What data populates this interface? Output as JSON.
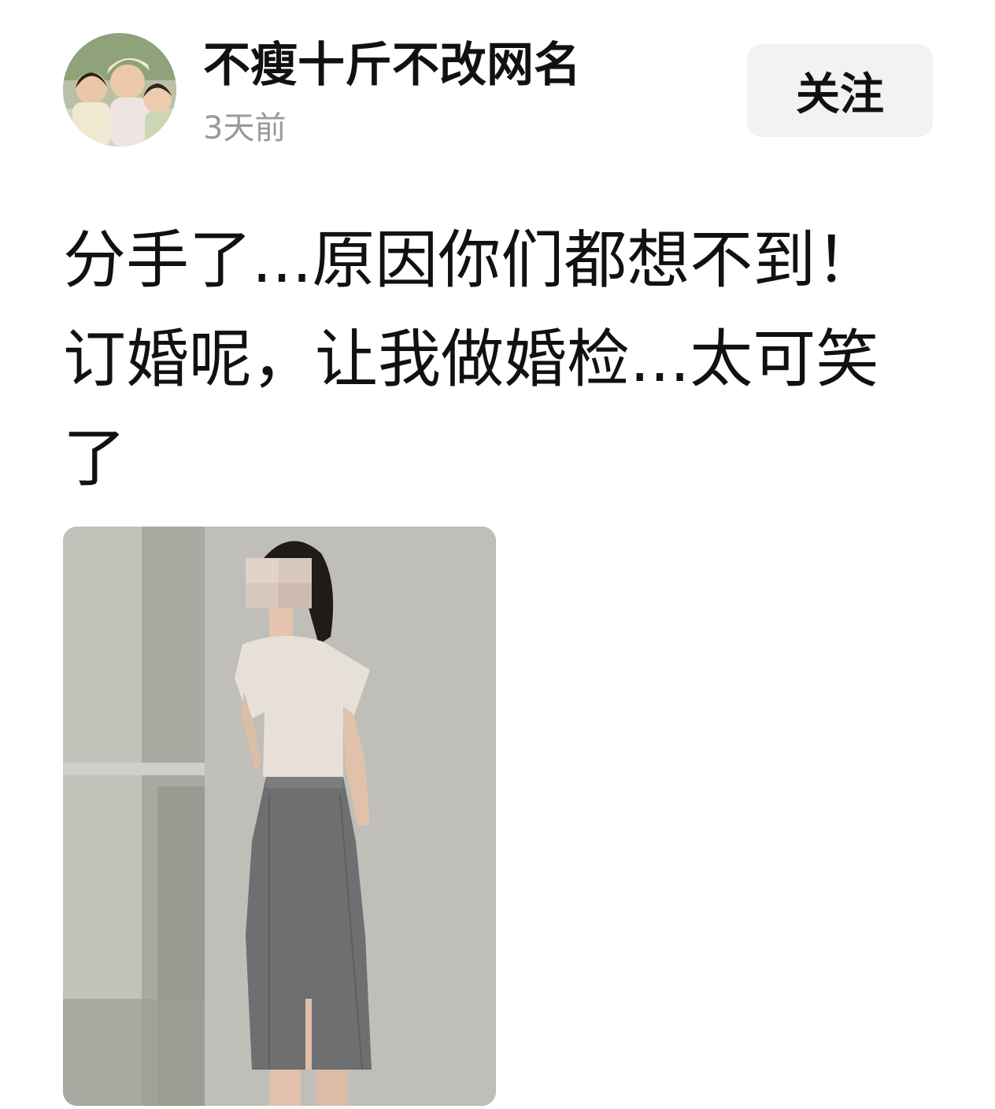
{
  "post": {
    "author": {
      "name": "不瘦十斤不改网名",
      "timestamp": "3天前"
    },
    "follow_label": "关注",
    "text": "分手了...原因你们都想不到！订婚呢，让我做婚检...太可笑了"
  },
  "colors": {
    "background": "#ffffff",
    "text": "#111111",
    "muted": "#999999",
    "button_bg": "#f2f2f2"
  }
}
